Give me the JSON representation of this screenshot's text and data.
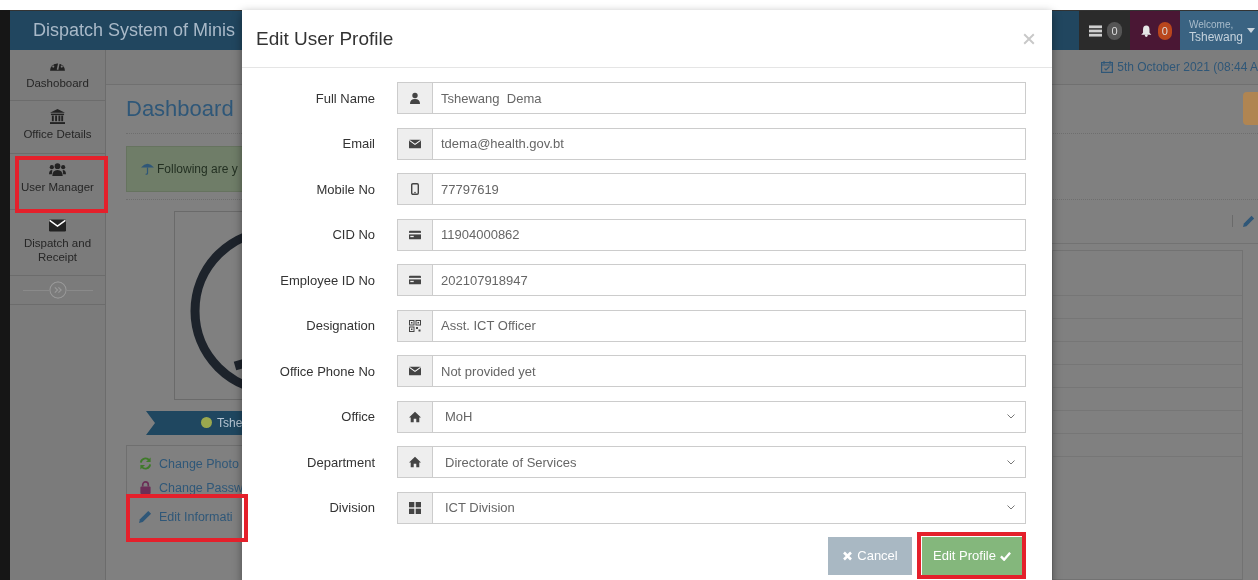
{
  "header": {
    "title": "Dispatch System of Minis",
    "counters": [
      {
        "kind": "tasks",
        "count": "0"
      },
      {
        "kind": "alerts",
        "count": "0"
      }
    ],
    "greeting": "Welcome,",
    "user": "Tshewang"
  },
  "sidebar": {
    "items": [
      {
        "label": "Dashoboard",
        "highlighted": false
      },
      {
        "label": "Office Details",
        "highlighted": false
      },
      {
        "label": "User Manager",
        "highlighted": true
      },
      {
        "label": "Dispatch and Receipt",
        "highlighted": false
      }
    ]
  },
  "date": "5th October 2021 (08:44 A",
  "page": {
    "title": "Dashboard",
    "notice": "Following are y",
    "profile_name": "Tshe",
    "online": true,
    "actions": [
      {
        "label": "Change Photo",
        "highlighted": false
      },
      {
        "label": "Change Passw",
        "highlighted": false
      },
      {
        "label": "Edit Informati",
        "highlighted": true
      }
    ]
  },
  "modal": {
    "title": "Edit User Profile",
    "fields": [
      {
        "label": "Full Name",
        "kind": "text",
        "value": "Tshewang  Dema"
      },
      {
        "label": "Email",
        "kind": "text",
        "value": "tdema@health.gov.bt"
      },
      {
        "label": "Mobile No",
        "kind": "text",
        "value": "77797619"
      },
      {
        "label": "CID No",
        "kind": "text",
        "value": "11904000862"
      },
      {
        "label": "Employee ID No",
        "kind": "text",
        "value": "202107918947"
      },
      {
        "label": "Designation",
        "kind": "text",
        "value": "Asst. ICT Officer"
      },
      {
        "label": "Office Phone No",
        "kind": "text",
        "value": "Not provided yet"
      },
      {
        "label": "Office",
        "kind": "select",
        "value": "MoH"
      },
      {
        "label": "Department",
        "kind": "select",
        "value": "Directorate of Services"
      },
      {
        "label": "Division",
        "kind": "select",
        "value": "ICT Division"
      }
    ],
    "buttons": [
      {
        "label": "Cancel",
        "kind": "cancel",
        "highlighted": false
      },
      {
        "label": "Edit Profile",
        "kind": "submit",
        "highlighted": true
      }
    ]
  }
}
